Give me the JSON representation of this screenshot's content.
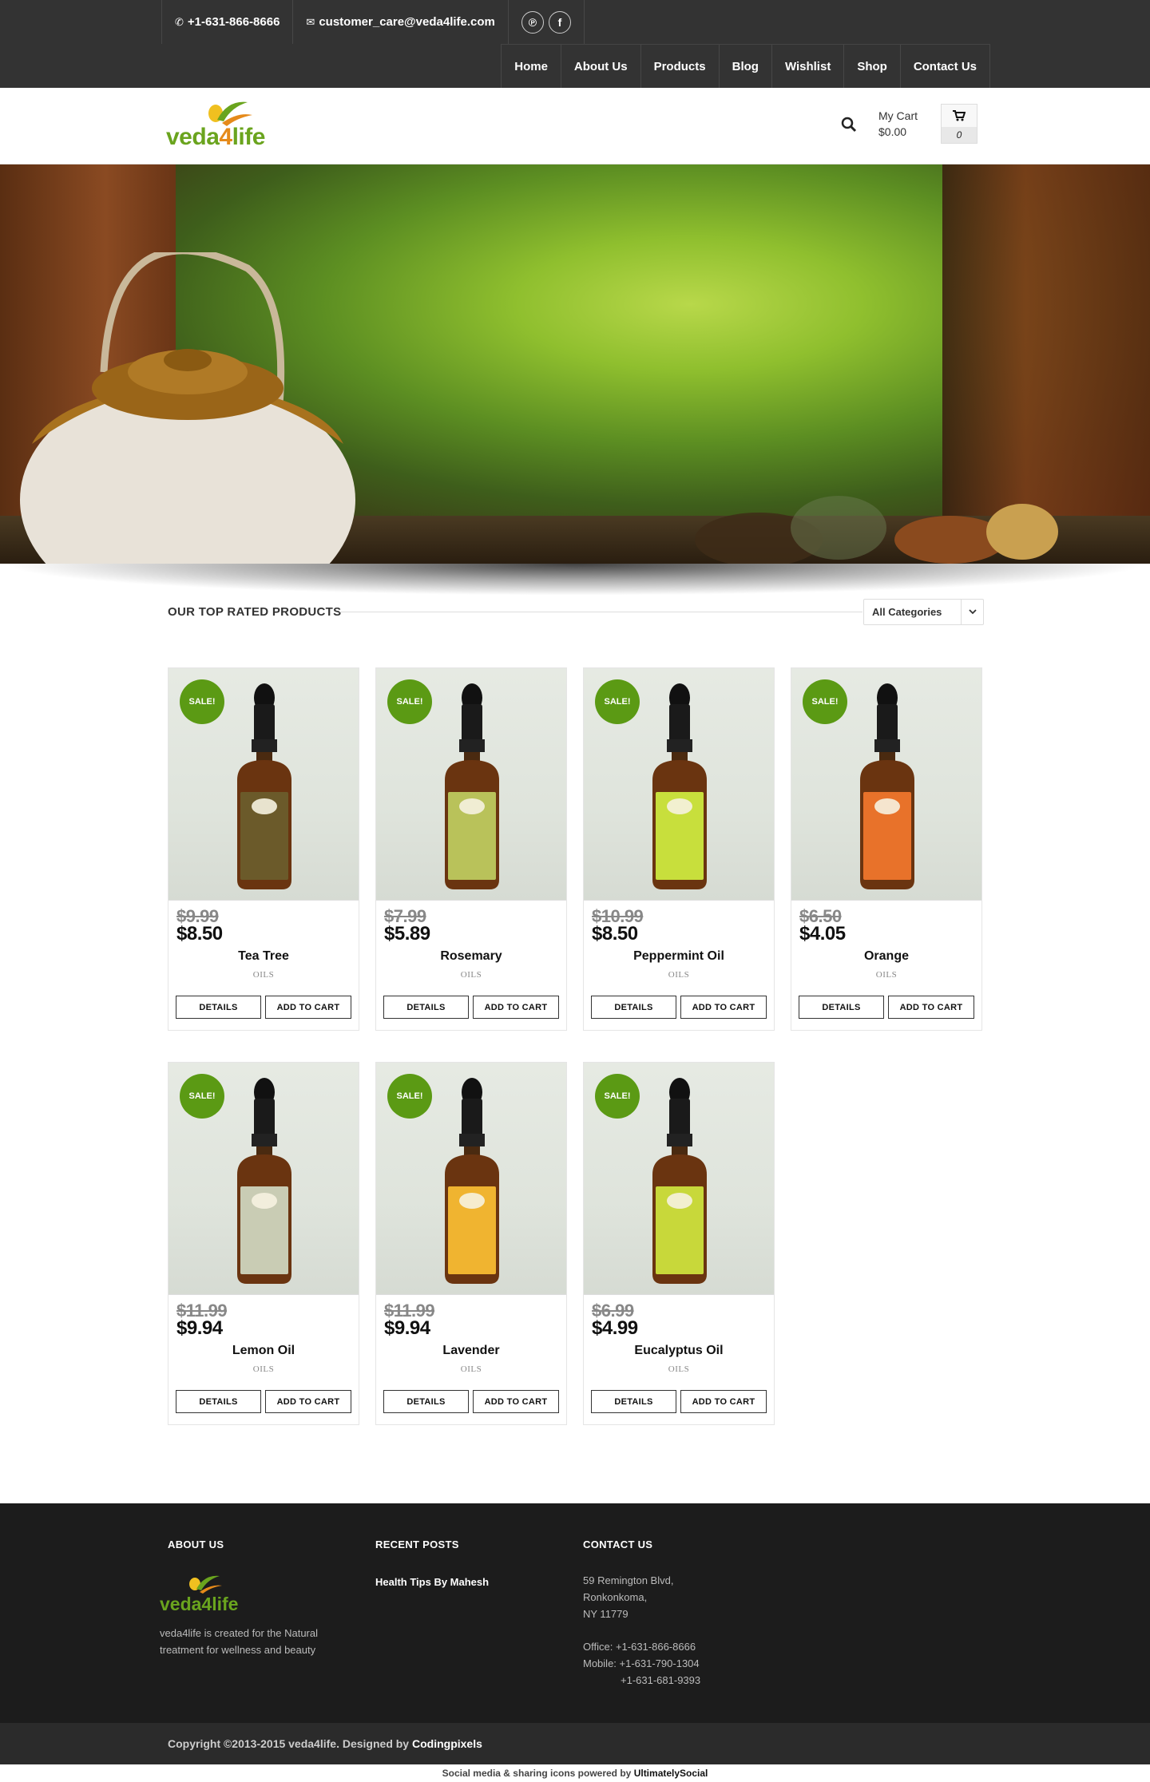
{
  "topbar": {
    "phone": "+1-631-866-8666",
    "email": "customer_care@veda4life.com",
    "social": [
      "pinterest-icon",
      "facebook-icon"
    ]
  },
  "nav": {
    "items": [
      "Home",
      "About Us",
      "Products",
      "Blog",
      "Wishlist",
      "Shop",
      "Contact Us"
    ]
  },
  "header": {
    "logo_text": "veda4life",
    "cart_label": "My Cart",
    "cart_total": "$0.00",
    "cart_count": "0"
  },
  "section": {
    "title": "OUR TOP RATED PRODUCTS",
    "category_select": "All Categories"
  },
  "products": [
    {
      "badge": "SALE!",
      "old_price": "$9.99",
      "price": "$8.50",
      "name": "Tea Tree",
      "category": "OILS",
      "label_text": "Tea Tree Oil",
      "label_color": "#6b5a2a",
      "details": "DETAILS",
      "add": "ADD TO CART"
    },
    {
      "badge": "SALE!",
      "old_price": "$7.99",
      "price": "$5.89",
      "name": "Rosemary",
      "category": "OILS",
      "label_text": "ROSEMARY OIL",
      "label_color": "#b9c25a",
      "details": "DETAILS",
      "add": "ADD TO CART"
    },
    {
      "badge": "SALE!",
      "old_price": "$10.99",
      "price": "$8.50",
      "name": "Peppermint Oil",
      "category": "OILS",
      "label_text": "Peppermint Oil",
      "label_color": "#c8df3c",
      "details": "DETAILS",
      "add": "ADD TO CART"
    },
    {
      "badge": "SALE!",
      "old_price": "$6.50",
      "price": "$4.05",
      "name": "Orange",
      "category": "OILS",
      "label_text": "ORANGE OIL",
      "label_color": "#e8722a",
      "details": "DETAILS",
      "add": "ADD TO CART"
    },
    {
      "badge": "SALE!",
      "old_price": "$11.99",
      "price": "$9.94",
      "name": "Lemon Oil",
      "category": "OILS",
      "label_text": "LEMON OIL",
      "label_color": "#c9ccb4",
      "details": "DETAILS",
      "add": "ADD TO CART"
    },
    {
      "badge": "SALE!",
      "old_price": "$11.99",
      "price": "$9.94",
      "name": "Lavender",
      "category": "OILS",
      "label_text": "LAVENDER OIL",
      "label_color": "#f0b430",
      "details": "DETAILS",
      "add": "ADD TO CART"
    },
    {
      "badge": "SALE!",
      "old_price": "$6.99",
      "price": "$4.99",
      "name": "Eucalyptus Oil",
      "category": "OILS",
      "label_text": "Eucalyptus Oil",
      "label_color": "#c8d83a",
      "details": "DETAILS",
      "add": "ADD TO CART"
    }
  ],
  "footer": {
    "about_title": "ABOUT US",
    "about_logo": "veda4life",
    "about_text_1": "veda4life is created for the Natural",
    "about_text_2": "treatment for wellness and beauty",
    "posts_title": "RECENT POSTS",
    "post_1": "Health Tips By Mahesh",
    "contact_title": "CONTACT US",
    "addr_1": "59 Remington Blvd,",
    "addr_2": "Ronkonkoma,",
    "addr_3": "NY 11779",
    "office": "Office:   +1-631-866-8666",
    "mobile": "Mobile: +1-631-790-1304",
    "mobile_2": "+1-631-681-9393",
    "copyright": "Copyright ©2013-2015 veda4life. Designed by",
    "designer": "Codingpixels",
    "powered": "Social media & sharing icons powered by",
    "powered_by": "UltimatelySocial"
  },
  "colors": {
    "topbar": "#333333",
    "sale_badge": "#5b9a14",
    "footer": "#1c1c1c"
  }
}
